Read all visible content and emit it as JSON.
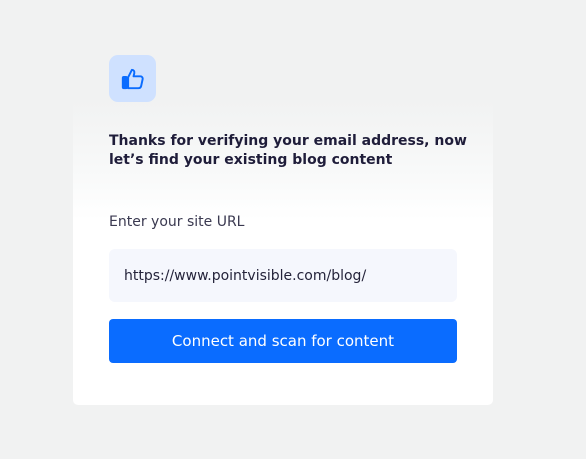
{
  "card": {
    "icon": "thumbs-up-icon",
    "heading": "Thanks for verifying your email address, now let’s find your existing blog content"
  },
  "form": {
    "url_label": "Enter your site URL",
    "url_value": "https://www.pointvisible.com/blog/",
    "submit_label": "Connect and scan for content"
  },
  "colors": {
    "accent": "#0a6cff",
    "icon_tile_bg": "#cfe1ff",
    "page_bg": "#f1f2f2",
    "heading_text": "#1f1d3a"
  }
}
